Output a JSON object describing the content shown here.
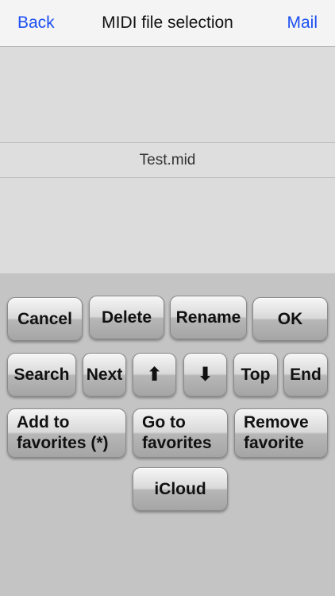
{
  "navbar": {
    "back_label": "Back",
    "title": "MIDI file selection",
    "mail_label": "Mail"
  },
  "files": [
    {
      "name": "Test.mid"
    }
  ],
  "buttons": {
    "cancel": "Cancel",
    "delete": "Delete",
    "rename": "Rename",
    "ok": "OK",
    "search": "Search",
    "next": "Next",
    "up": "⬆",
    "down": "⬇",
    "top": "Top",
    "end": "End",
    "add_favorites": "Add to\nfavorites (*)",
    "go_favorites": "Go to\nfavorites",
    "remove_favorite": "Remove\nfavorite",
    "icloud": "iCloud"
  },
  "colors": {
    "accent": "#1b4ff2"
  }
}
